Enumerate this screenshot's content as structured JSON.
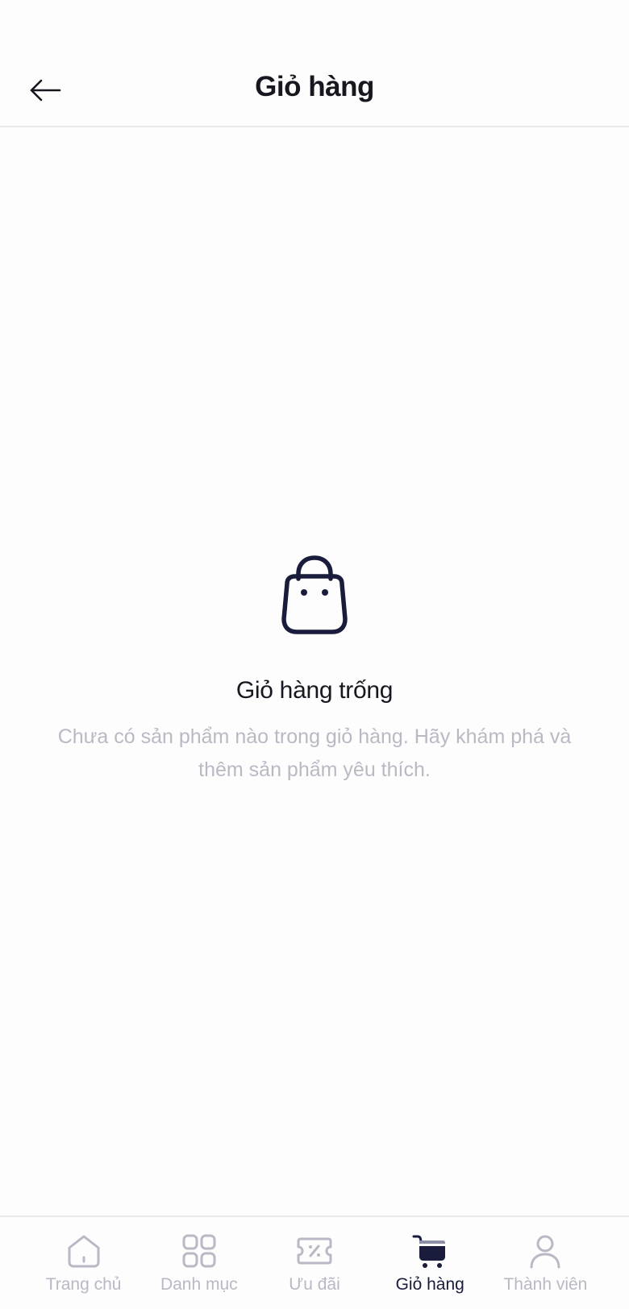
{
  "header": {
    "title": "Giỏ hàng",
    "back_icon": "arrow-left-icon"
  },
  "empty_state": {
    "icon": "shopping-bag-icon",
    "title": "Giỏ hàng trống",
    "description": "Chưa có sản phẩm nào trong giỏ hàng. Hãy khám phá và thêm sản phẩm yêu thích."
  },
  "bottom_nav": {
    "items": [
      {
        "label": "Trang chủ",
        "icon": "home-icon",
        "active": false
      },
      {
        "label": "Danh mục",
        "icon": "grid-icon",
        "active": false
      },
      {
        "label": "Ưu đãi",
        "icon": "ticket-icon",
        "active": false
      },
      {
        "label": "Giỏ hàng",
        "icon": "cart-icon",
        "active": true
      },
      {
        "label": "Thành viên",
        "icon": "user-icon",
        "active": false
      }
    ]
  },
  "colors": {
    "background": "#fdfdfe",
    "text_primary": "#16171f",
    "text_muted": "#b9b9c4",
    "accent_navy": "#191c3a",
    "divider": "#e9e9ee"
  }
}
